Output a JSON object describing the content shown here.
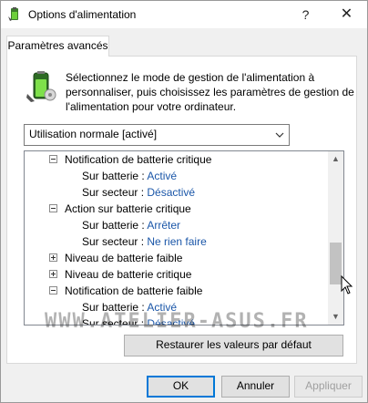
{
  "window": {
    "title": "Options d'alimentation",
    "help_glyph": "?",
    "close_glyph": "✕"
  },
  "tab": {
    "label": "Paramètres avancés"
  },
  "description": "Sélectionnez le mode de gestion de l'alimentation à personnaliser, puis choisissez les paramètres de gestion de l'alimentation pour votre ordinateur.",
  "plan_select": {
    "value": "Utilisation normale [activé]"
  },
  "tree": {
    "items": [
      {
        "type": "category",
        "expanded": true,
        "label": "Notification de batterie critique"
      },
      {
        "type": "setting",
        "label": "Sur batterie :",
        "value": "Activé"
      },
      {
        "type": "setting",
        "label": "Sur secteur :",
        "value": "Désactivé"
      },
      {
        "type": "category",
        "expanded": true,
        "label": "Action sur batterie critique"
      },
      {
        "type": "setting",
        "label": "Sur batterie :",
        "value": "Arrêter"
      },
      {
        "type": "setting",
        "label": "Sur secteur :",
        "value": "Ne rien faire"
      },
      {
        "type": "category",
        "expanded": false,
        "label": "Niveau de batterie faible"
      },
      {
        "type": "category",
        "expanded": false,
        "label": "Niveau de batterie critique"
      },
      {
        "type": "category",
        "expanded": true,
        "label": "Notification de batterie faible"
      },
      {
        "type": "setting",
        "label": "Sur batterie :",
        "value": "Activé"
      },
      {
        "type": "setting",
        "label": "Sur secteur :",
        "value": "Désactivé"
      }
    ],
    "scroll_position": 0.75
  },
  "watermark": "WWW.ATELIER-ASUS.FR",
  "buttons": {
    "restore": "Restaurer les valeurs par défaut",
    "ok": "OK",
    "cancel": "Annuler",
    "apply": "Appliquer"
  },
  "colors": {
    "value_link": "#1a56a8",
    "ok_border": "#0078d7",
    "disabled_text": "#a0a0a0"
  }
}
